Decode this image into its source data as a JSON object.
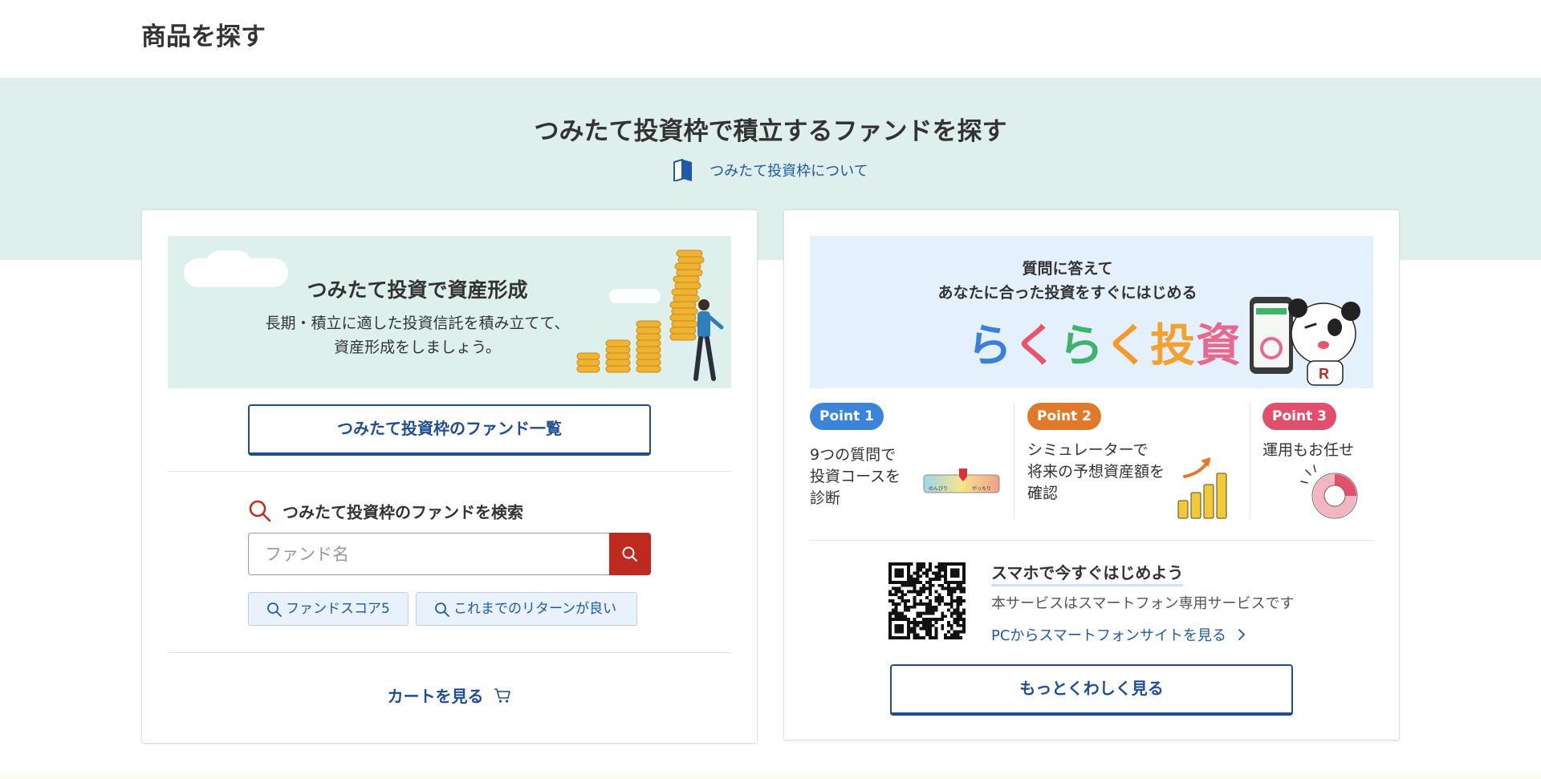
{
  "page": {
    "heading": "商品を探す"
  },
  "hero": {
    "title": "つみたて投資枠で積立するファンドを探す",
    "about_link": "つみたて投資枠について"
  },
  "left_card": {
    "banner_title": "つみたて投資で資産形成",
    "banner_sub_line1": "長期・積立に適した投資信託を積み立てて、",
    "banner_sub_line2": "資産形成をしましょう。",
    "fund_list_button": "つみたて投資枠のファンド一覧",
    "search_heading": "つみたて投資枠のファンドを検索",
    "search_placeholder": "ファンド名",
    "chips": [
      "ファンドスコア5",
      "これまでのリターンが良い"
    ],
    "cart_link": "カートを見る"
  },
  "right_card": {
    "banner_line1": "質問に答えて",
    "banner_line2": "あなたに合った投資をすぐにはじめる",
    "logo_chars": [
      "ら",
      "く",
      "ら",
      "く",
      "投",
      "資"
    ],
    "logo_colors": [
      "#3b7fd6",
      "#e9556b",
      "#3fb36c",
      "#f39a2b",
      "#f2a230",
      "#e66a8d"
    ],
    "points": [
      {
        "badge": "Point 1",
        "lines": [
          "9つの質問で",
          "投資コースを",
          "診断"
        ],
        "color": "#3b84d8"
      },
      {
        "badge": "Point 2",
        "lines": [
          "シミュレーターで",
          "将来の予想資産額を",
          "確認"
        ],
        "color": "#e07a2a"
      },
      {
        "badge": "Point 3",
        "lines": [
          "運用もお任せ"
        ],
        "color": "#e0506c"
      }
    ],
    "gauge_left": "のんびり",
    "gauge_right": "がっちり",
    "smartphone_title": "スマホで今すぐはじめよう",
    "smartphone_sub": "本サービスはスマートフォン専用サービスです",
    "smartphone_link": "PCからスマートフォンサイトを見る",
    "more_button": "もっとくわしく見る"
  },
  "colors": {
    "hero_bg": "#dff0ec",
    "primary_blue": "#1e4d94",
    "link_blue": "#1f5aa8",
    "search_red": "#bf2a1f"
  },
  "icons": {
    "about": "book-icon",
    "search": "magnifier-icon",
    "cart": "cart-icon",
    "chevron": "chevron-right-icon"
  }
}
